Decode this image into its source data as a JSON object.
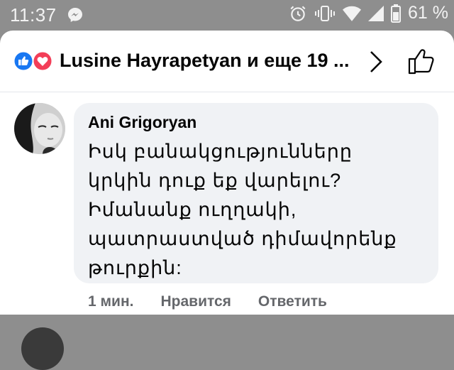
{
  "status_bar": {
    "time": "11:37",
    "battery_percent": "61 %",
    "icons": [
      "messenger-icon",
      "alarm-icon",
      "vibrate-icon",
      "wifi-icon",
      "signal-icon",
      "battery-icon"
    ]
  },
  "header": {
    "title": "Lusine Hayrapetyan и еще 19 ...",
    "reaction_icons": [
      "like-reaction-icon",
      "love-reaction-icon"
    ],
    "colors": {
      "like": "#1877f2",
      "love": "#f33e58"
    }
  },
  "comment": {
    "author": "Ani Grigoryan",
    "text": "Իսկ բանակցությունները կրկին դուք եք վարելու? Իմանանք ուղղակի, պատրաստված դիմավորենք թուրքին:",
    "time": "1 мин.",
    "like_label": "Нравится",
    "reply_label": "Ответить"
  }
}
